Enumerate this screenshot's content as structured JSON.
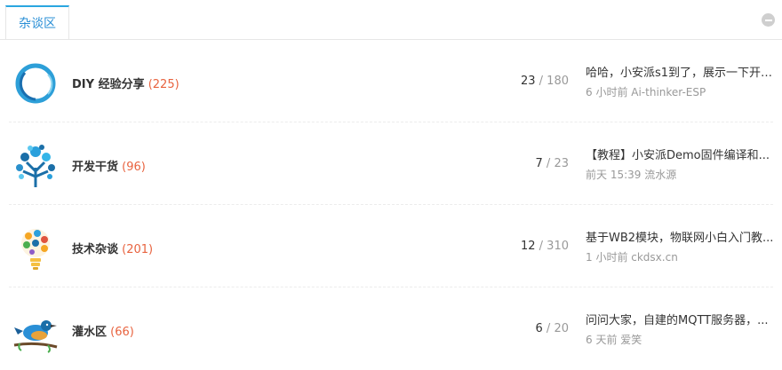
{
  "section_tab": "杂谈区",
  "forums": [
    {
      "name": "DIY 经验分享",
      "count": "(225)",
      "threads": "23",
      "sep": "/",
      "posts": "180",
      "last_title": "哈哈，小安派s1到了，展示一下开 ...",
      "last_meta": "6 小时前 Ai-thinker-ESP",
      "icon": "ring-logo-icon"
    },
    {
      "name": "开发干货",
      "count": "(96)",
      "threads": "7",
      "sep": "/",
      "posts": "23",
      "last_title": "【教程】小安派Demo固件编译和...",
      "last_meta": "前天 15:39 流水源",
      "icon": "tech-tree-icon"
    },
    {
      "name": "技术杂谈",
      "count": "(201)",
      "threads": "12",
      "sep": "/",
      "posts": "310",
      "last_title": "基于WB2模块，物联网小白入门教...",
      "last_meta": "1 小时前 ckdsx.cn",
      "icon": "lightbulb-icon"
    },
    {
      "name": "灌水区",
      "count": "(66)",
      "threads": "6",
      "sep": "/",
      "posts": "20",
      "last_title": "问问大家，自建的MQTT服务器，...",
      "last_meta": "6 天前 爱笑",
      "icon": "bird-icon"
    }
  ]
}
